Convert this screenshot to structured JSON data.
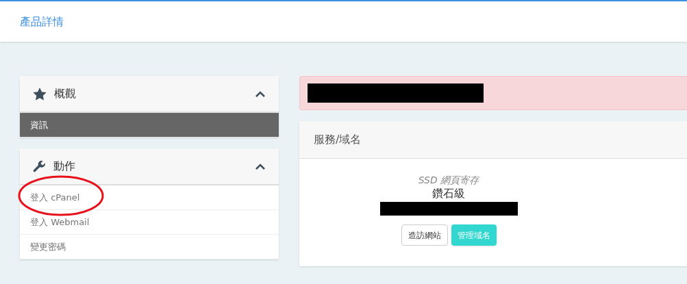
{
  "header": {
    "title": "產品詳情"
  },
  "sidebar": [
    {
      "title": "概觀",
      "kind": "star",
      "expanded": true,
      "items": [
        {
          "label": "資訊",
          "selected": true
        }
      ]
    },
    {
      "title": "動作",
      "kind": "wrench",
      "expanded": true,
      "items": [
        {
          "label": "登入 cPanel",
          "selected": false,
          "annotated": true
        },
        {
          "label": "登入 Webmail",
          "selected": false,
          "annotated": false
        },
        {
          "label": "變更密碼",
          "selected": false,
          "annotated": false
        }
      ]
    }
  ],
  "alert": {
    "redacted": true
  },
  "service_panel": {
    "title": "服務/域名",
    "product_group": "SSD 網頁寄存",
    "product_name": "鑽石級",
    "domain_redacted": true,
    "buttons": [
      {
        "label": "造訪網站",
        "kind": "outline"
      },
      {
        "label": "管理域名",
        "kind": "primary"
      }
    ]
  }
}
